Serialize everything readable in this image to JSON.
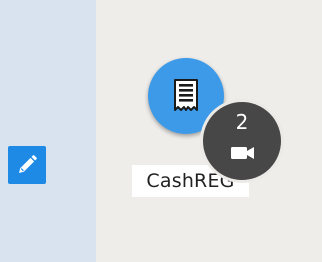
{
  "device": {
    "label": "CashREG",
    "icon": "cash-register-receipt-icon",
    "circle_color": "#3d9ae8"
  },
  "camera_badge": {
    "count": "2",
    "icon": "video-camera-icon",
    "badge_color": "#474747"
  },
  "toolbar": {
    "edit_icon": "pencil-icon",
    "edit_color": "#1e8ae6"
  },
  "colors": {
    "left_panel": "#d9e2ef",
    "canvas": "#efedea"
  }
}
